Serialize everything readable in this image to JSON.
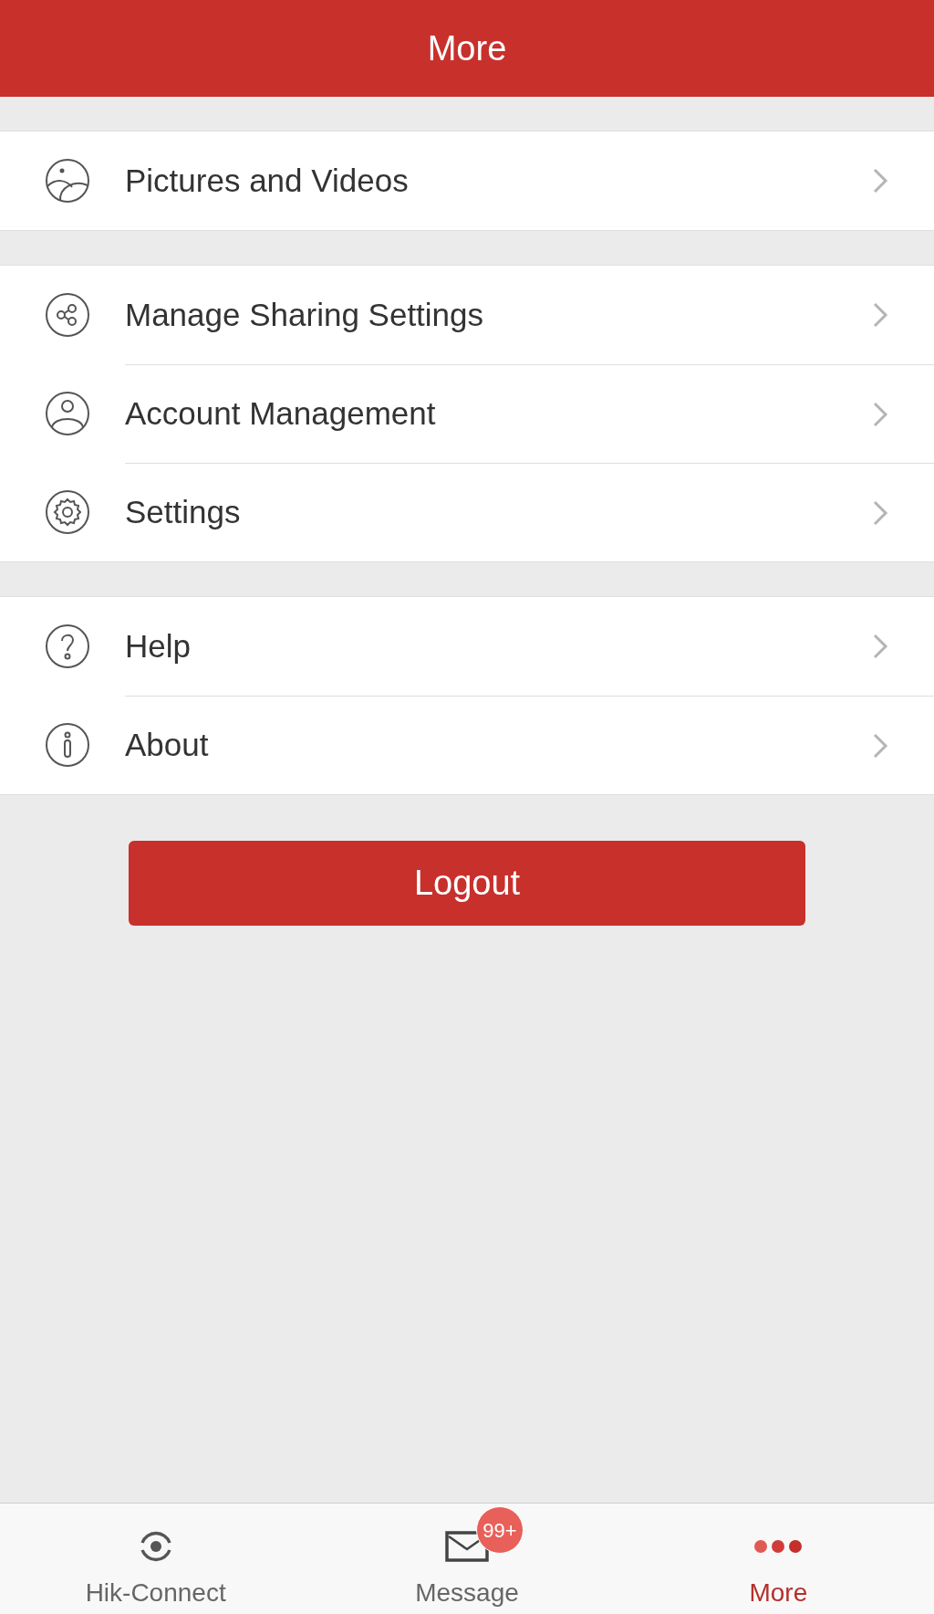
{
  "header": {
    "title": "More"
  },
  "sections": [
    {
      "items": [
        {
          "kind": "picture",
          "label": "Pictures and Videos"
        }
      ]
    },
    {
      "items": [
        {
          "kind": "share",
          "label": "Manage Sharing Settings"
        },
        {
          "kind": "account",
          "label": "Account Management"
        },
        {
          "kind": "gear",
          "label": "Settings"
        }
      ]
    },
    {
      "items": [
        {
          "kind": "help",
          "label": "Help"
        },
        {
          "kind": "info",
          "label": "About"
        }
      ]
    }
  ],
  "logout_button": "Logout",
  "tab_bar": [
    {
      "kind": "target",
      "label": "Hik-Connect",
      "selected": false
    },
    {
      "kind": "mail",
      "label": "Message",
      "badge": "99+",
      "selected": false
    },
    {
      "kind": "dots",
      "label": "More",
      "selected": true
    }
  ]
}
